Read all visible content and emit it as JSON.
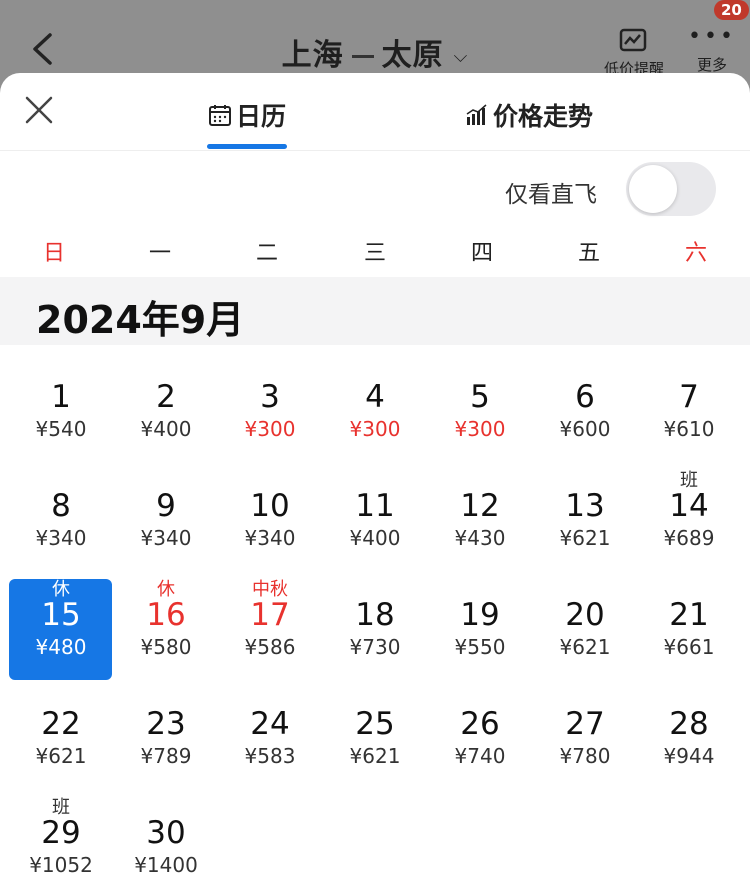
{
  "header": {
    "title_from": "上海",
    "title_to": "太原",
    "alert_label": "低价提醒",
    "more_label": "更多",
    "badge": "20"
  },
  "tabs": [
    {
      "label": "日历",
      "icon": "calendar-icon",
      "active": true
    },
    {
      "label": "价格走势",
      "icon": "bar-chart-icon",
      "active": false
    }
  ],
  "filter": {
    "direct_only_label": "仅看直飞",
    "direct_only": false
  },
  "weekdays": [
    "日",
    "一",
    "二",
    "三",
    "四",
    "五",
    "六"
  ],
  "month_title": "2024年9月",
  "colors": {
    "accent": "#1677e5",
    "holiday_red": "#e8322e"
  },
  "days": [
    {
      "day": "1",
      "price": "¥540"
    },
    {
      "day": "2",
      "price": "¥400"
    },
    {
      "day": "3",
      "price": "¥300",
      "low": true
    },
    {
      "day": "4",
      "price": "¥300",
      "low": true
    },
    {
      "day": "5",
      "price": "¥300",
      "low": true
    },
    {
      "day": "6",
      "price": "¥600"
    },
    {
      "day": "7",
      "price": "¥610"
    },
    {
      "day": "8",
      "price": "¥340"
    },
    {
      "day": "9",
      "price": "¥340"
    },
    {
      "day": "10",
      "price": "¥340"
    },
    {
      "day": "11",
      "price": "¥400"
    },
    {
      "day": "12",
      "price": "¥430"
    },
    {
      "day": "13",
      "price": "¥621"
    },
    {
      "day": "14",
      "price": "¥689",
      "tag": "班"
    },
    {
      "day": "15",
      "price": "¥480",
      "tag": "休",
      "selected": true
    },
    {
      "day": "16",
      "price": "¥580",
      "tag": "休",
      "holiday": true
    },
    {
      "day": "17",
      "price": "¥586",
      "tag": "中秋",
      "holiday": true
    },
    {
      "day": "18",
      "price": "¥730"
    },
    {
      "day": "19",
      "price": "¥550"
    },
    {
      "day": "20",
      "price": "¥621"
    },
    {
      "day": "21",
      "price": "¥661"
    },
    {
      "day": "22",
      "price": "¥621"
    },
    {
      "day": "23",
      "price": "¥789"
    },
    {
      "day": "24",
      "price": "¥583"
    },
    {
      "day": "25",
      "price": "¥621"
    },
    {
      "day": "26",
      "price": "¥740"
    },
    {
      "day": "27",
      "price": "¥780"
    },
    {
      "day": "28",
      "price": "¥944"
    },
    {
      "day": "29",
      "price": "¥1052",
      "tag": "班"
    },
    {
      "day": "30",
      "price": "¥1400"
    }
  ]
}
